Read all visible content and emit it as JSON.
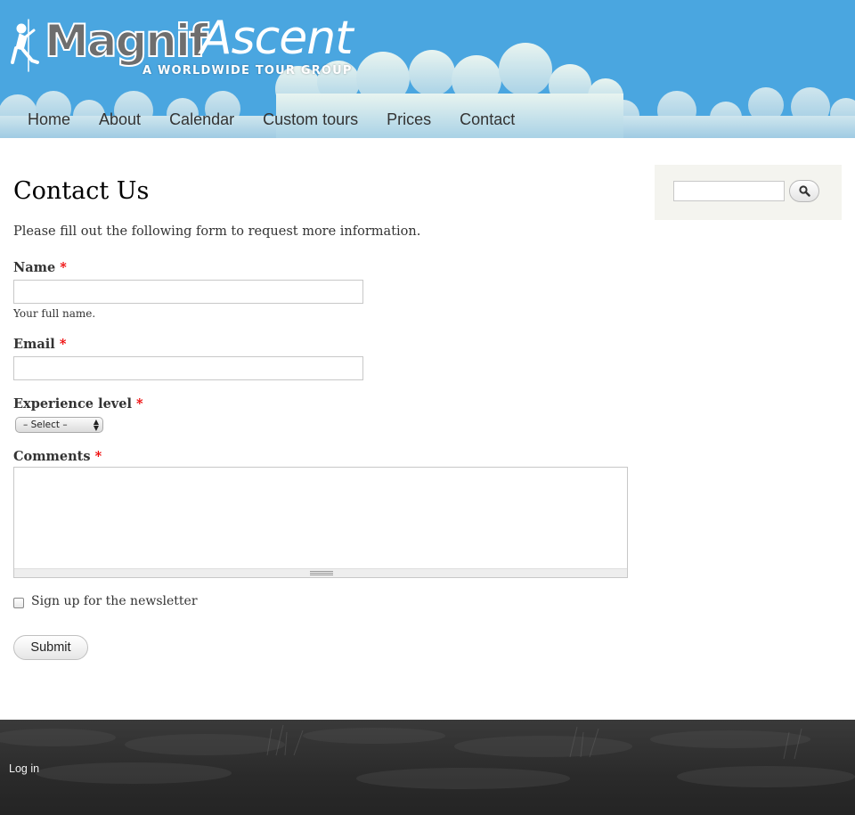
{
  "site": {
    "logo_primary": "Magnif",
    "logo_secondary": "Ascent",
    "tagline": "A WORLDWIDE TOUR GROUP",
    "logo_icon": "climber-icon"
  },
  "nav": {
    "items": [
      {
        "label": "Home"
      },
      {
        "label": "About"
      },
      {
        "label": "Calendar"
      },
      {
        "label": "Custom tours"
      },
      {
        "label": "Prices"
      },
      {
        "label": "Contact"
      }
    ]
  },
  "page": {
    "title": "Contact Us",
    "intro": "Please fill out the following form to request more information."
  },
  "form": {
    "required_marker": "*",
    "name": {
      "label": "Name",
      "value": "",
      "description": "Your full name."
    },
    "email": {
      "label": "Email",
      "value": ""
    },
    "experience": {
      "label": "Experience level",
      "selected": "– Select –"
    },
    "comments": {
      "label": "Comments",
      "value": ""
    },
    "newsletter": {
      "label": "Sign up for the newsletter",
      "checked": false
    },
    "submit_label": "Submit"
  },
  "sidebar": {
    "search": {
      "value": "",
      "button_icon": "search-icon"
    }
  },
  "footer": {
    "login_label": "Log in"
  },
  "colors": {
    "header_sky": "#4aa6e0",
    "required": "#e00000",
    "footer": "#2a2a2a",
    "sidebar_bg": "#f4f4ef"
  }
}
